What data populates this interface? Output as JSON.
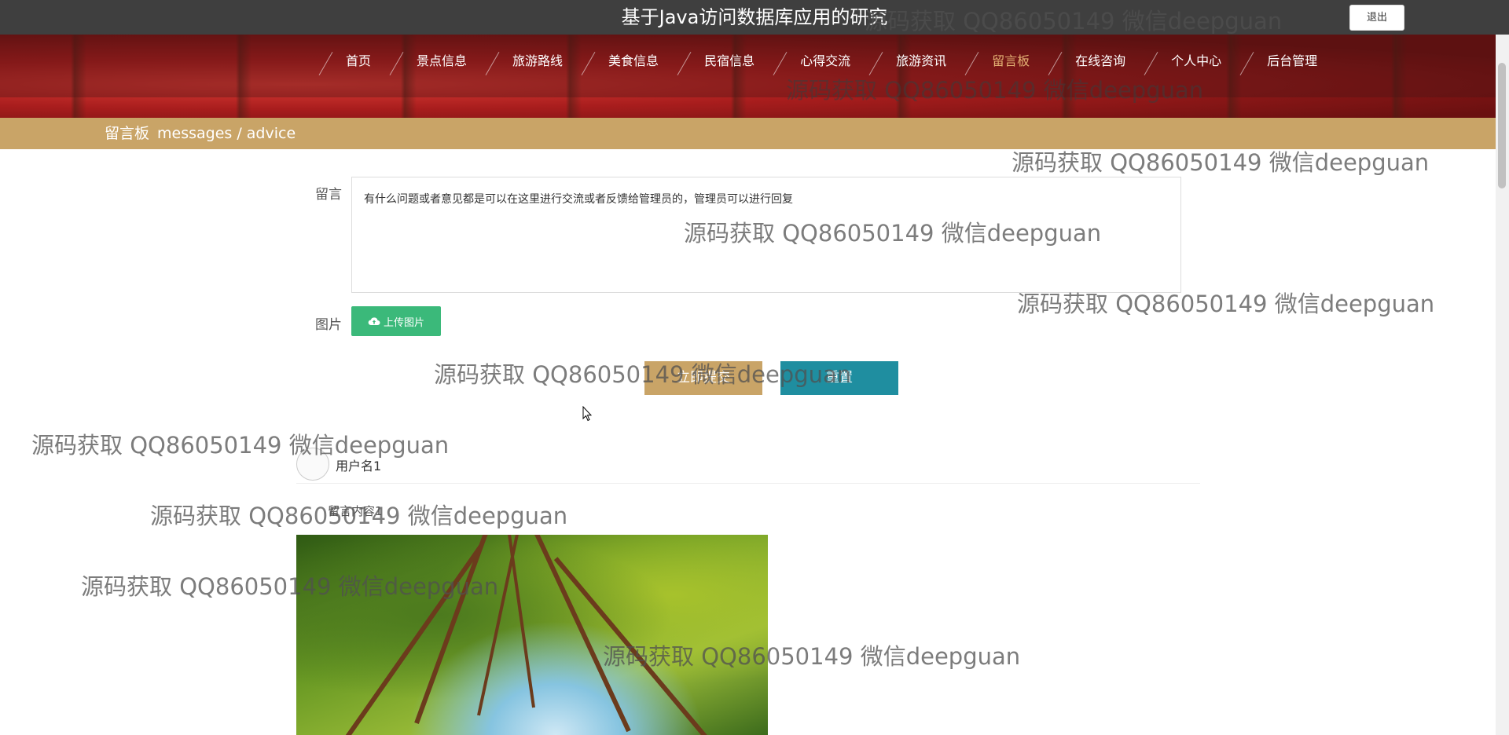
{
  "header": {
    "title": "基于Java访问数据库应用的研究",
    "logout_label": "退出"
  },
  "nav": {
    "items": [
      {
        "label": "首页"
      },
      {
        "label": "景点信息"
      },
      {
        "label": "旅游路线"
      },
      {
        "label": "美食信息"
      },
      {
        "label": "民宿信息"
      },
      {
        "label": "心得交流"
      },
      {
        "label": "旅游资讯"
      },
      {
        "label": "留言板",
        "active": true
      },
      {
        "label": "在线咨询"
      },
      {
        "label": "个人中心"
      },
      {
        "label": "后台管理"
      }
    ],
    "active_color": "#e3b073"
  },
  "page": {
    "title": "留言板",
    "subtitle": "messages / advice"
  },
  "form": {
    "message_label": "留言",
    "message_value": "有什么问题或者意见都是可以在这里进行交流或者反馈给管理员的，管理员可以进行回复",
    "image_label": "图片",
    "upload_label": "上传图片",
    "submit_label": "立即提交",
    "reset_label": "重置"
  },
  "messages": [
    {
      "username": "用户名1",
      "content_label": "留言内容1"
    }
  ],
  "watermark": "源码获取 QQ86050149 微信deepguan",
  "colors": {
    "topbar": "#3f3f3f",
    "strip": "#c9a467",
    "upload": "#3bb97a",
    "submit": "#c9a467",
    "reset": "#1f8ea0"
  }
}
